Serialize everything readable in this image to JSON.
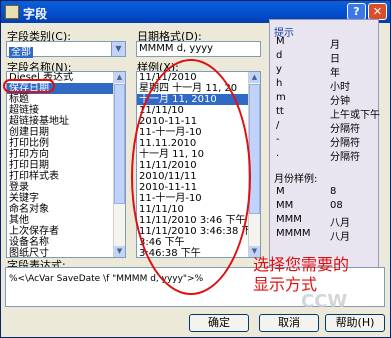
{
  "window": {
    "title": "字段"
  },
  "left": {
    "category_label": "字段类别(C):",
    "category_value": "全部",
    "name_label": "字段名称(N):",
    "names": [
      "Diesel 表达式",
      "保存日期",
      "标题",
      "超链接",
      "超链接基地址",
      "创建日期",
      "打印比例",
      "打印方向",
      "打印日期",
      "打印样式表",
      "登录",
      "关键字",
      "命名对象",
      "其他",
      "上次保存者",
      "设备名称",
      "图纸尺寸",
      "文件大小",
      "文件名"
    ],
    "selected_index": 1,
    "expr_label": "字段表达式:",
    "expr_value": "%<\\AcVar SaveDate \\f \"MMMM d, yyyy\">%"
  },
  "mid": {
    "format_label": "日期格式(D):",
    "format_value": "MMMM d, yyyy",
    "examples_label": "样例(X):",
    "examples": [
      "11/11/2010",
      "星期四  十一月 11, 20",
      "十一月 11, 2010",
      "11/11/10",
      "2010-11-11",
      "11-十一月-10",
      "11.11.2010",
      "十一月 11, 10",
      "11/11/2010",
      "2010/11/11",
      "2010-11-11",
      "11-十一月-10",
      "11/11/10",
      "11/11/2010 3:46 下午",
      "11/11/2010 3:46:38 下",
      "3:46 下午",
      "3:46:38 下午"
    ],
    "selected_index": 2
  },
  "hint": {
    "title": "提示",
    "rows": [
      [
        "M",
        "月"
      ],
      [
        "d",
        "日"
      ],
      [
        "y",
        "年"
      ],
      [
        "h",
        "小时"
      ],
      [
        "m",
        "分钟"
      ],
      [
        "tt",
        "上午或下午"
      ],
      [
        "/",
        "分隔符"
      ],
      [
        "-",
        "分隔符"
      ],
      [
        ".",
        "分隔符"
      ]
    ],
    "sample_title": "月份样例:",
    "samples": [
      [
        "M",
        "8"
      ],
      [
        "MM",
        "08"
      ],
      [
        "MMM",
        "八月"
      ],
      [
        "MMMM",
        "八月"
      ]
    ]
  },
  "buttons": {
    "ok": "确定",
    "cancel": "取消",
    "help": "帮助(H)"
  },
  "annotation": {
    "line1": "选择您需要的",
    "line2": "显示方式"
  },
  "watermark": "CCW"
}
